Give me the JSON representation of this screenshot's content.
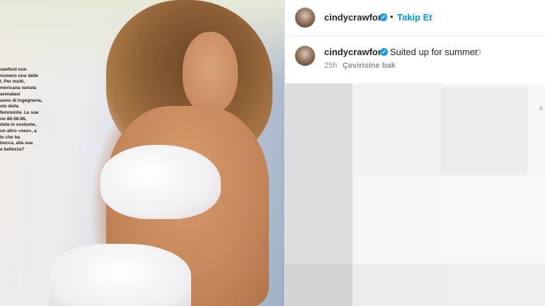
{
  "post": {
    "username": "cindycrawford",
    "follow_label": "Takip Et",
    "separator": "•"
  },
  "photo": {
    "magazine_text": "rawford non\nnumero uno delle\nl. Per multi,\nmericana vanuta\n arenatasi\nanno di ingegneria,\nolo della\nfemminile. Le sue\nno 86-58-86,\ndola in costume,\nun altro «neo», a\nlo che ha\nbocca, alla sua\ne bellezza?"
  },
  "caption": {
    "username": "cindycrawford",
    "text": "Suited up for summer",
    "time": "25h",
    "translate_label": "Çevirisine bak"
  },
  "edge_glyph": "e",
  "colors": {
    "accent": "#0095f6",
    "verified": "#1d9bf0",
    "muted": "#8e8e8e"
  }
}
